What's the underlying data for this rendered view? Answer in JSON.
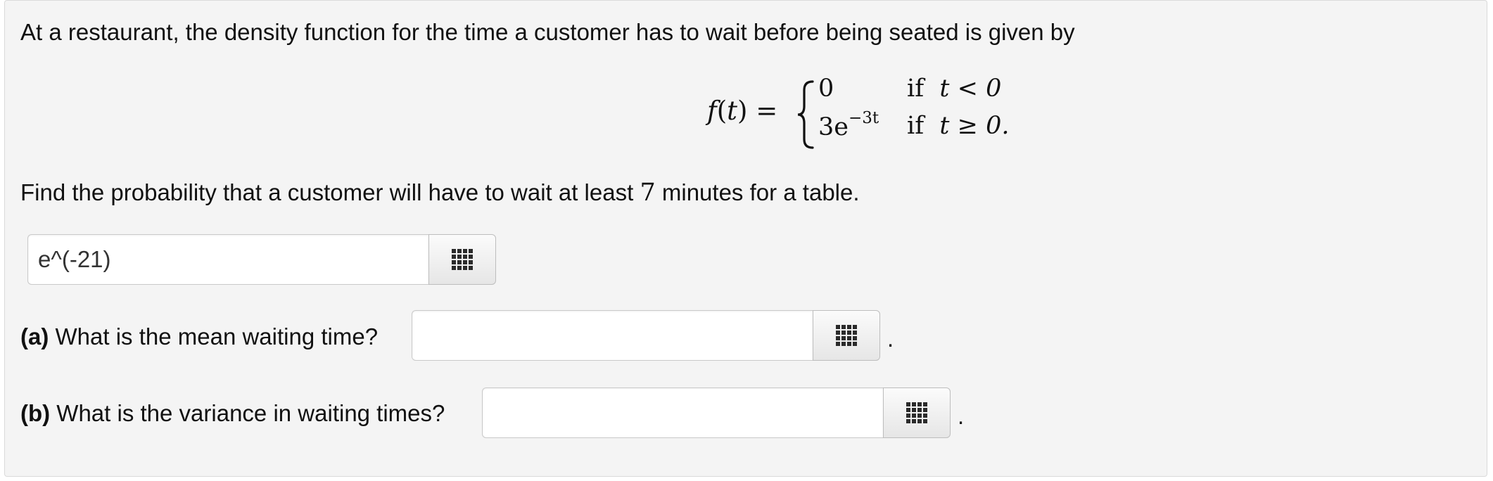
{
  "problem": {
    "intro": "At a restaurant, the density function for the time a customer has to wait before being seated is given by",
    "equation": {
      "lhs_func": "f",
      "lhs_var": "t",
      "lhs_equals": "=",
      "case1_value": "0",
      "case1_condition_if": "if",
      "case1_condition": "t < 0",
      "case2_base": "3e",
      "case2_exponent": "−3t",
      "case2_condition_if": "if",
      "case2_condition": "t ≥ 0."
    },
    "question_before": "Find the probability that a customer will have to wait at least ",
    "question_number": "7",
    "question_after": " minutes for a table.",
    "answer_main_value": "e^(-21)",
    "part_a": {
      "label": "(a)",
      "text": " What is the mean waiting time?",
      "value": "",
      "trailing": "."
    },
    "part_b": {
      "label": "(b)",
      "text": " What is the variance in waiting times?",
      "value": "",
      "trailing": "."
    }
  }
}
